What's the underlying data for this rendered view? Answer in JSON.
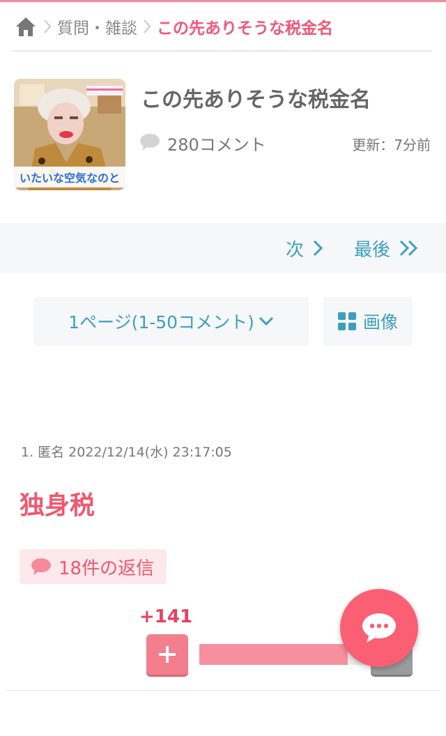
{
  "breadcrumb": {
    "home_icon": "home-icon",
    "category": "質問・雑談",
    "current": "この先ありそうな税金名"
  },
  "topic": {
    "thumbnail_caption": "いたいな空気なのと",
    "title": "この先ありそうな税金名",
    "comment_count": "280コメント",
    "updated": "更新：7分前"
  },
  "pager": {
    "next_label": "次",
    "last_label": "最後"
  },
  "page_select": {
    "selected": "1ページ(1-50コメント)"
  },
  "image_button": {
    "label": "画像",
    "icon": "grid-icon"
  },
  "comment": {
    "number": "1.",
    "author": "匿名",
    "datetime": "2022/12/14(水) 23:17:05",
    "body": "独身税",
    "replies_label": "18件の返信",
    "plus_votes": "+141",
    "plus_share": 0.85
  },
  "colors": {
    "accent_pink": "#f2576e",
    "link_blue": "#3c9fbf",
    "plus_button": "#f27e8e",
    "fab": "#fa5f73"
  }
}
